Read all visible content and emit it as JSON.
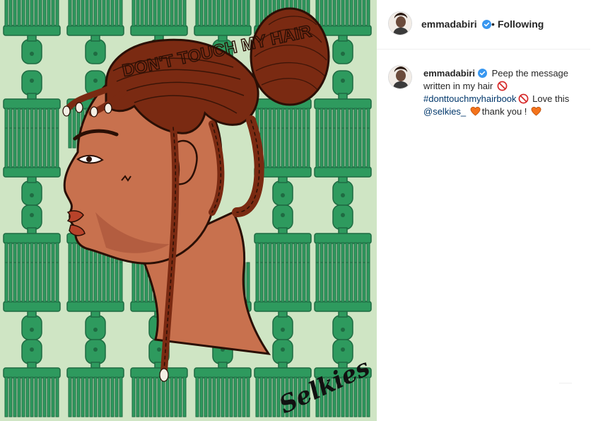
{
  "post": {
    "author": {
      "username": "emmadabiri",
      "verified": true,
      "follow_state": "Following",
      "separator": "•"
    },
    "image": {
      "signature": "Selkies",
      "hair_lettering": "DON'T TOUCH MY HAIR",
      "colors": {
        "background": "#cfe5c4",
        "comb": "#2e9a5e",
        "comb_dark": "#1f6b42",
        "skin": "#c8714e",
        "hair": "#7a2a12"
      }
    },
    "caption": {
      "username": "emmadabiri",
      "text_1": "Peep the message written in my hair",
      "hashtag": "#donttouchmyhairbook",
      "text_2": "Love this",
      "mention": "@selkies_",
      "text_3": "thank you !",
      "emojis": [
        "no-entry-icon",
        "no-entry-icon",
        "orange-heart-icon",
        "orange-heart-icon"
      ]
    }
  }
}
